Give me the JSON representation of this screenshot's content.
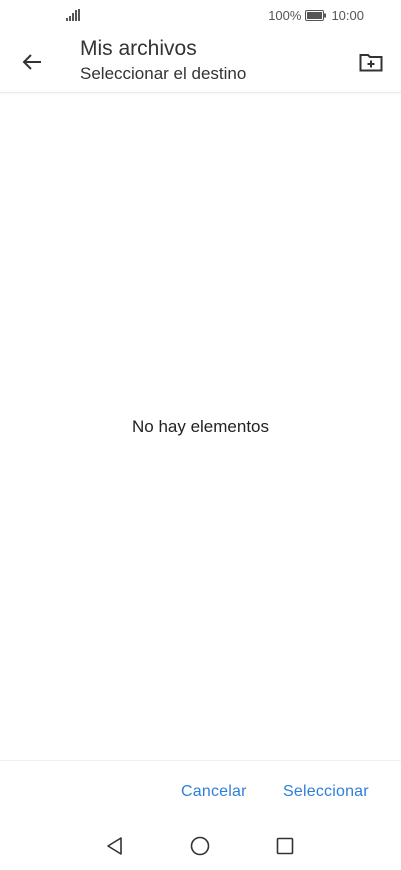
{
  "status_bar": {
    "battery_percent": "100%",
    "time": "10:00",
    "signal_icon": "signal-bars-icon",
    "battery_icon": "battery-full-icon"
  },
  "app_bar": {
    "title": "Mis archivos",
    "subtitle": "Seleccionar el destino",
    "back_icon": "arrow-left-icon",
    "new_folder_icon": "folder-plus-icon"
  },
  "content": {
    "empty_message": "No hay elementos"
  },
  "actions": {
    "cancel_label": "Cancelar",
    "select_label": "Seleccionar"
  },
  "colors": {
    "accent": "#2f7fd8",
    "text": "#222222"
  }
}
